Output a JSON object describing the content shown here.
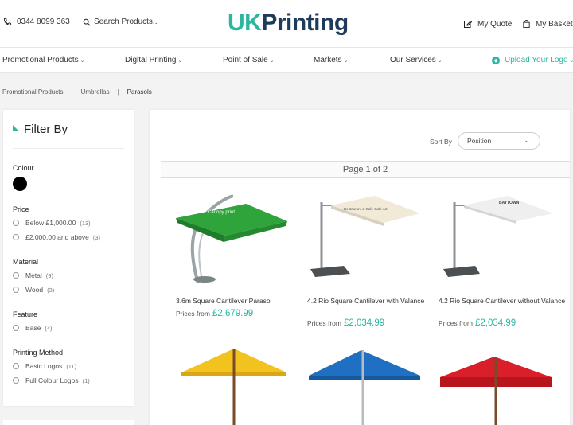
{
  "header": {
    "phone": "0344 8099 363",
    "search_label": "Search Products..",
    "logo_uk": "UK",
    "logo_printing": "Printing",
    "quote_label": "My Quote",
    "basket_label": "My Basket"
  },
  "nav": {
    "items": [
      "Promotional Products",
      "Digital Printing",
      "Point of Sale",
      "Markets",
      "Our Services"
    ],
    "upload_label": "Upload Your Logo"
  },
  "breadcrumb": [
    "Promotional Products",
    "Umbrellas",
    "Parasols"
  ],
  "filter": {
    "title": "Filter By",
    "colour_title": "Colour",
    "price_title": "Price",
    "price_options": [
      {
        "label": "Below £1,000.00",
        "count": "(13)"
      },
      {
        "label": "£2,000.00 and above",
        "count": "(3)"
      }
    ],
    "material_title": "Material",
    "material_options": [
      {
        "label": "Metal",
        "count": "(9)"
      },
      {
        "label": "Wood",
        "count": "(3)"
      }
    ],
    "feature_title": "Feature",
    "feature_options": [
      {
        "label": "Base",
        "count": "(4)"
      }
    ],
    "printing_title": "Printing Method",
    "printing_options": [
      {
        "label": "Basic Logos",
        "count": "(11)"
      },
      {
        "label": "Full Colour Logos",
        "count": "(1)"
      }
    ]
  },
  "toolbar": {
    "sort_label": "Sort By",
    "sort_value": "Position",
    "pager": "Page 1 of 2"
  },
  "products": [
    {
      "name": "3.6m Square Cantilever Parasol",
      "price_prefix": "Prices from",
      "price": "£2,679.99",
      "canopy_text": "Canopy print"
    },
    {
      "name": "4.2 Rio Square Cantilever with Valance",
      "price_prefix": "Prices from",
      "price": "£2,034.99",
      "canopy_text": "Restaurant & Cafe  Cafe Art"
    },
    {
      "name": "4.2 Rio Square Cantilever without Valance",
      "price_prefix": "Prices from",
      "price": "£2,034.99",
      "canopy_text": "BAYTOWN"
    },
    {
      "name": "",
      "price_prefix": "",
      "price": ""
    },
    {
      "name": "",
      "price_prefix": "",
      "price": ""
    },
    {
      "name": "",
      "price_prefix": "",
      "price": ""
    }
  ],
  "colors": {
    "accent": "#2ab7a0",
    "logo_dark": "#1f3b5c",
    "band": "#f3f3f3",
    "swatch_black": "#000000"
  }
}
